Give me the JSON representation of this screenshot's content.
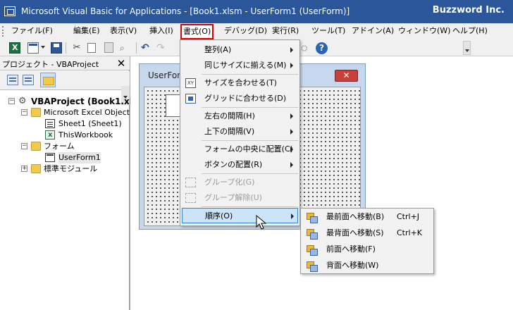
{
  "window": {
    "title": "Microsoft Visual Basic for Applications - [Book1.xlsm - UserForm1 (UserForm)]",
    "brand": "Buzzword Inc."
  },
  "menubar": {
    "items": [
      {
        "label": "ファイル(F)"
      },
      {
        "label": "編集(E)"
      },
      {
        "label": "表示(V)"
      },
      {
        "label": "挿入(I)"
      },
      {
        "label": "書式(O)"
      },
      {
        "label": "デバッグ(D)"
      },
      {
        "label": "実行(R)"
      },
      {
        "label": "ツール(T)"
      },
      {
        "label": "アドイン(A)"
      },
      {
        "label": "ウィンドウ(W)"
      },
      {
        "label": "ヘルプ(H)"
      }
    ],
    "active_index": 4,
    "active_border_color": "#e00000"
  },
  "toolbar": {
    "icons": [
      "excel-icon",
      "insert-userform-icon",
      "save-icon",
      "cut-icon",
      "copy-icon",
      "paste-icon",
      "find-icon",
      "undo-icon",
      "redo-icon",
      "help-icon"
    ]
  },
  "project": {
    "title": "プロジェクト - VBAProject",
    "close_label": "✕",
    "tree": {
      "root": "VBAProject (Book1.xls",
      "excel_objects_folder": "Microsoft Excel Object",
      "sheet1": "Sheet1 (Sheet1)",
      "thisworkbook": "ThisWorkbook",
      "forms_folder": "フォーム",
      "userform1": "UserForm1",
      "modules_folder": "標準モジュール"
    }
  },
  "designer": {
    "form_title": "UserForm",
    "close_label": "✕"
  },
  "format_menu": {
    "items": [
      {
        "label": "整列(A)",
        "submenu": true
      },
      {
        "label": "同じサイズに揃える(M)",
        "submenu": true
      },
      {
        "label": "サイズを合わせる(T)"
      },
      {
        "label": "グリッドに合わせる(D)"
      },
      {
        "label": "左右の間隔(H)",
        "submenu": true
      },
      {
        "label": "上下の間隔(V)",
        "submenu": true
      },
      {
        "label": "フォームの中央に配置(C)",
        "submenu": true
      },
      {
        "label": "ボタンの配置(R)",
        "submenu": true
      },
      {
        "label": "グループ化(G)",
        "disabled": true
      },
      {
        "label": "グループ解除(U)",
        "disabled": true
      },
      {
        "label": "順序(O)",
        "submenu": true,
        "highlighted": true
      }
    ],
    "highlight_color": "#cce4f7"
  },
  "order_submenu": {
    "items": [
      {
        "label": "最前面へ移動(B)",
        "shortcut": "Ctrl+J"
      },
      {
        "label": "最背面へ移動(S)",
        "shortcut": "Ctrl+K"
      },
      {
        "label": "前面へ移動(F)",
        "shortcut": ""
      },
      {
        "label": "背面へ移動(W)",
        "shortcut": ""
      }
    ]
  }
}
